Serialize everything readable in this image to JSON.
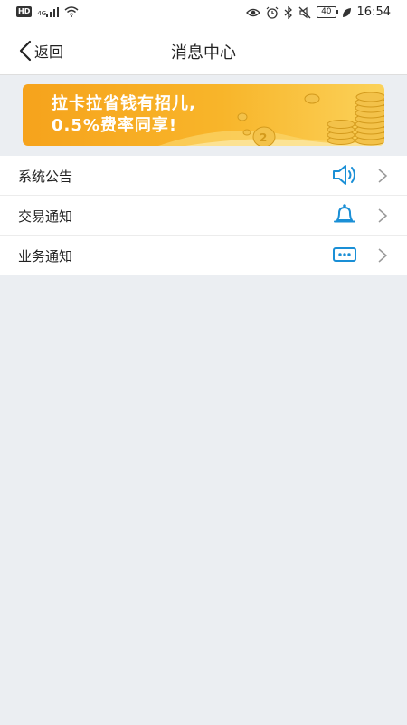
{
  "status_bar": {
    "hd": "HD",
    "network": "4G",
    "battery": "40",
    "time": "16:54"
  },
  "header": {
    "back_label": "返回",
    "title": "消息中心"
  },
  "banner": {
    "line1": "拉卡拉省钱有招儿,",
    "line2": "0.5%费率同享!"
  },
  "messages": [
    {
      "label": "系统公告",
      "icon": "speaker-icon"
    },
    {
      "label": "交易通知",
      "icon": "bell-icon"
    },
    {
      "label": "业务通知",
      "icon": "message-dots-icon"
    }
  ],
  "colors": {
    "accent": "#1a8fd6",
    "banner": "#f6a31c",
    "background": "#ebeef2"
  }
}
